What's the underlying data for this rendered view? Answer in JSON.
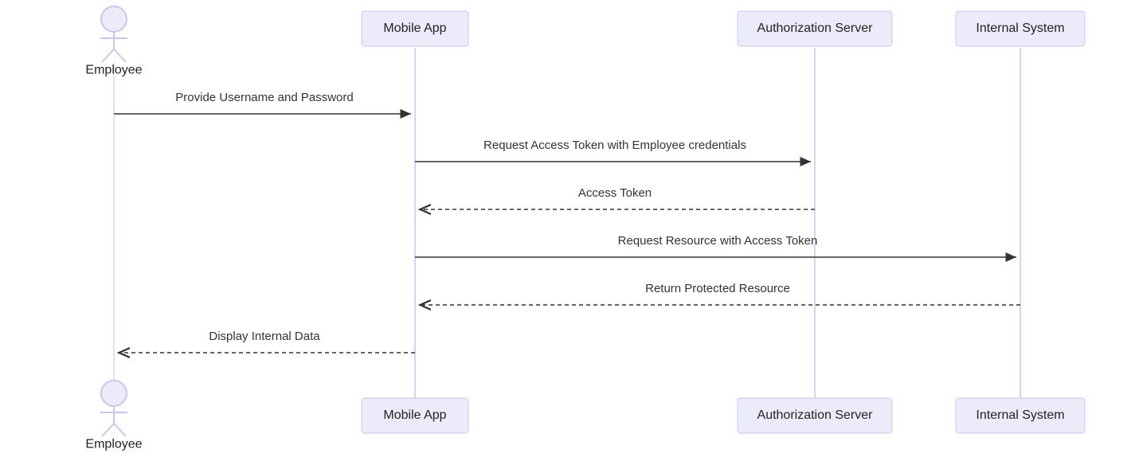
{
  "diagram": {
    "participants": {
      "actor": {
        "label": "Employee"
      },
      "p1": {
        "label": "Mobile App"
      },
      "p2": {
        "label": "Authorization Server"
      },
      "p3": {
        "label": "Internal System"
      }
    },
    "messages": {
      "m1": "Provide Username and Password",
      "m2": "Request Access Token with Employee credentials",
      "m3": "Access Token",
      "m4": "Request Resource with Access Token",
      "m5": "Return Protected Resource",
      "m6": "Display Internal Data"
    }
  }
}
